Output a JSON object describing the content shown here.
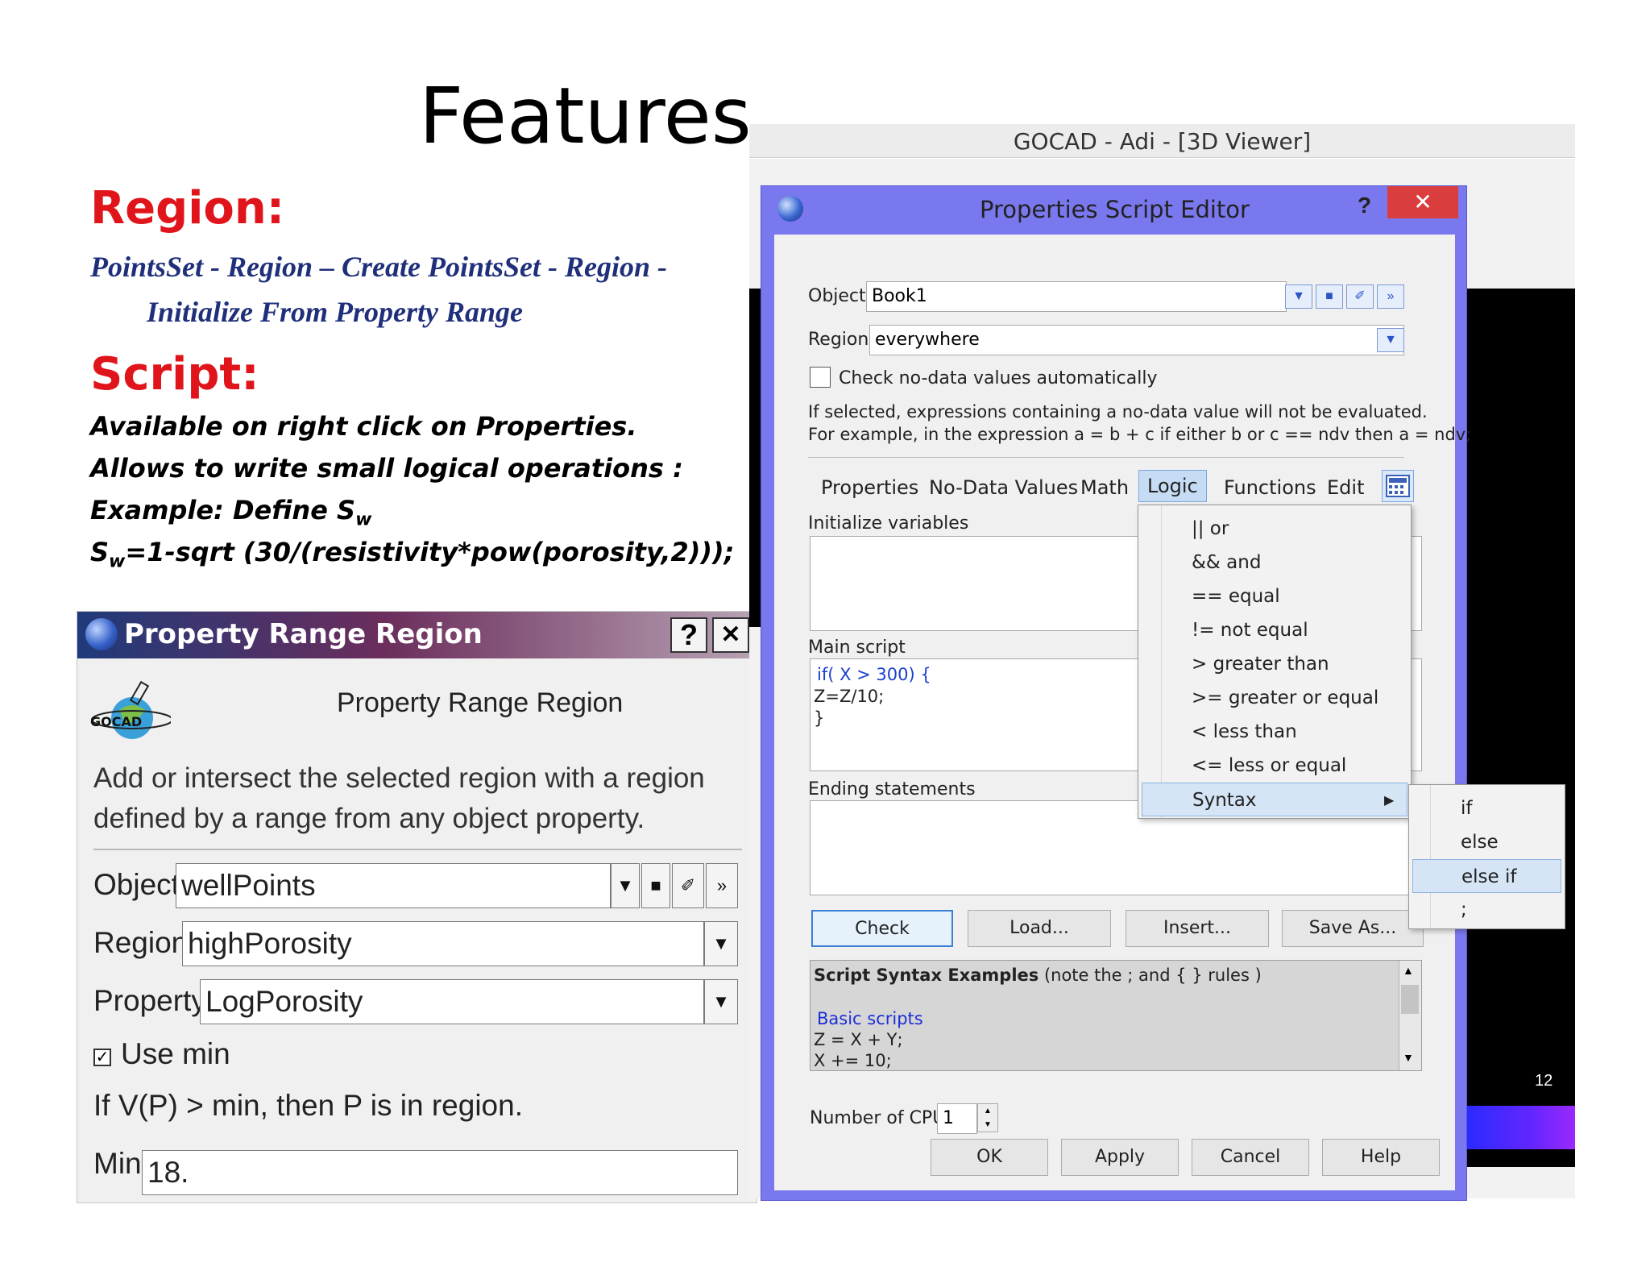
{
  "slide": {
    "title": "Features",
    "region_heading": "Region:",
    "menu_path_line1": "PointsSet - Region – Create PointsSet - Region -",
    "menu_path_line2": "Initialize From Property Range",
    "script_heading": "Script:",
    "script_lines": [
      "Available on right click on Properties.",
      "Allows to write small logical operations :"
    ],
    "example_prefix": "Example: Define S",
    "example_sub": "w",
    "formula_prefix": "S",
    "formula_sub": "w",
    "formula_rest": "=1-sqrt (30/(resistivity*pow(porosity,2)));"
  },
  "prr_dialog": {
    "title": "Property Range Region",
    "help_btn": "?",
    "close_btn": "✕",
    "logo_text": "GOCAD",
    "heading": "Property Range Region",
    "description": "Add or intersect the selected region with a region defined by a range from any object property.",
    "object_label": "Object",
    "object_value": "wellPoints",
    "region_label": "Region",
    "region_value": "highPorosity",
    "property_label": "Property",
    "property_value": "LogPorosity",
    "use_min_checked": true,
    "use_min_label": "Use min",
    "rule_text": "If V(P) > min, then P is in region.",
    "min_label": "Min",
    "min_value": "18."
  },
  "gocad_window": {
    "title": "GOCAD - Adi  - [3D Viewer]",
    "colorbar_tick": "12"
  },
  "script_editor": {
    "title": "Properties Script Editor",
    "help_btn": "?",
    "close_btn": "✕",
    "object_label": "Object",
    "object_value": "Book1",
    "region_label": "Region",
    "region_value": "everywhere",
    "nodata_check_label": "Check no-data values automatically",
    "nodata_checked": false,
    "note_line1": "If selected, expressions containing a no-data value will not be evaluated.",
    "note_line2": "For example, in the expression a = b + c if either b or c == ndv then a = ndv;",
    "tabs": [
      "Properties",
      "No-Data Values",
      "Math",
      "Logic",
      "Functions",
      "Edit"
    ],
    "active_tab": "Logic",
    "init_label": "Initialize variables",
    "main_label": "Main script",
    "main_code": [
      "if( X > 300) {",
      "Z=Z/10;",
      "}"
    ],
    "ending_label": "Ending statements",
    "buttons": {
      "check": "Check",
      "load": "Load...",
      "insert": "Insert...",
      "save_as": "Save As..."
    },
    "examples_title_bold": "Script Syntax Examples",
    "examples_title_rest": " (note the ; and { } rules )",
    "examples_link": "Basic scripts",
    "examples_code": [
      "Z = X + Y;",
      "X += 10;"
    ],
    "cpu_label": "Number of CPU",
    "cpu_value": "1",
    "bottom_buttons": {
      "ok": "OK",
      "apply": "Apply",
      "cancel": "Cancel",
      "help": "Help"
    }
  },
  "logic_menu": {
    "items": [
      "|| or",
      "&& and",
      "== equal",
      "!= not equal",
      "> greater than",
      ">= greater or equal",
      "< less than",
      "<= less or equal",
      "Syntax"
    ],
    "highlighted": "Syntax",
    "submenu": [
      "if",
      "else",
      "else if",
      ";"
    ],
    "submenu_highlighted": "else if"
  },
  "colors": {
    "accent_red": "#e0151b",
    "menu_path_blue": "#1f2f7a",
    "dialog_frame": "#7a78ee",
    "close_red": "#d93d3d",
    "highlight": "#d5e5f6"
  }
}
